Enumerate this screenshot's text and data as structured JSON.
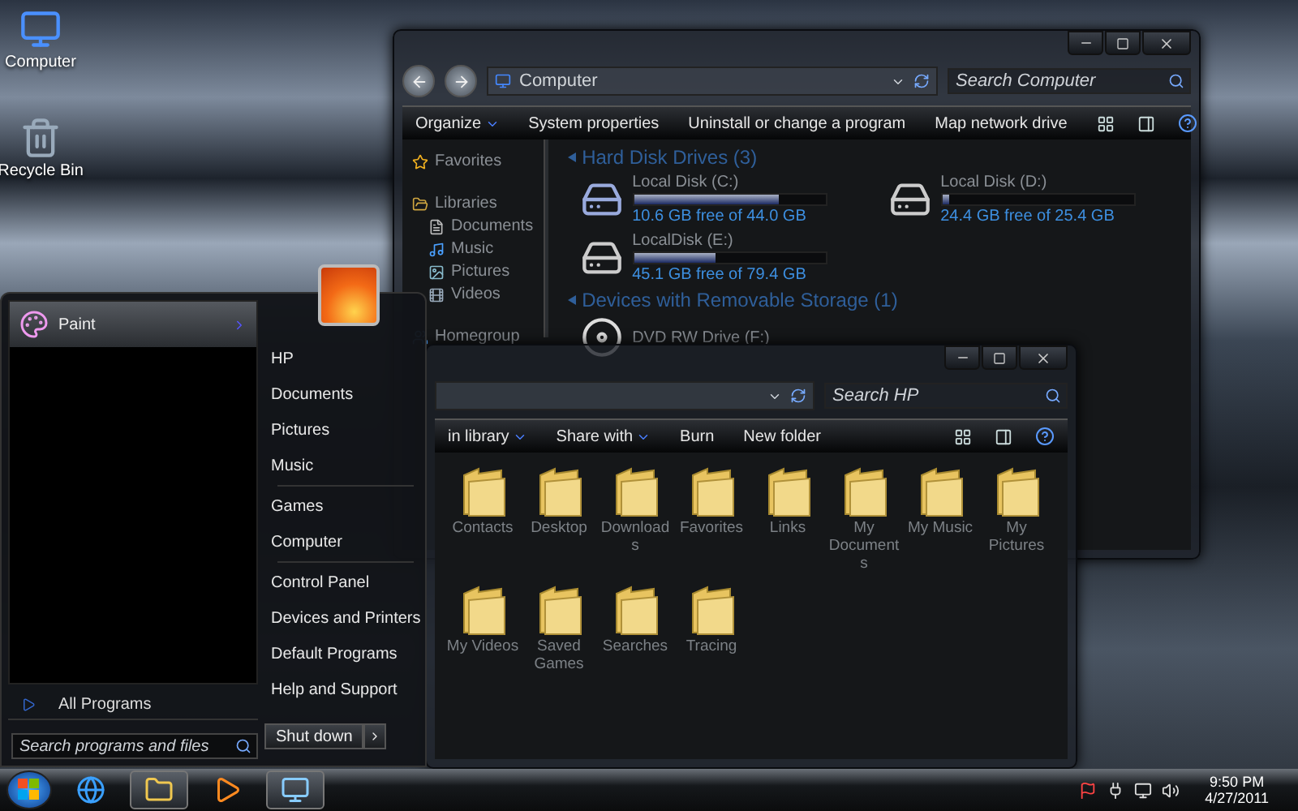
{
  "desktop_icons": [
    {
      "label": "Computer",
      "kind": "computer"
    },
    {
      "label": "Recycle Bin",
      "kind": "bin"
    }
  ],
  "computer_window": {
    "address": "Computer",
    "search": {
      "placeholder": "Search Computer"
    },
    "toolbar": [
      {
        "label": "Organize",
        "dropdown": true
      },
      {
        "label": "System properties",
        "dropdown": false
      },
      {
        "label": "Uninstall or change a program",
        "dropdown": false
      },
      {
        "label": "Map network drive",
        "dropdown": false
      }
    ],
    "nav": [
      {
        "label": "Favorites",
        "kind": "star"
      },
      {
        "label": "Libraries",
        "kind": "library",
        "children": [
          {
            "label": "Documents",
            "kind": "document"
          },
          {
            "label": "Music",
            "kind": "music"
          },
          {
            "label": "Pictures",
            "kind": "picture"
          },
          {
            "label": "Videos",
            "kind": "video"
          }
        ]
      },
      {
        "label": "Homegroup",
        "kind": "homegroup"
      }
    ],
    "groups": [
      {
        "title": "Hard Disk Drives (3)",
        "drives": [
          {
            "name": "Local Disk (C:)",
            "kind": "system",
            "level": 0.76,
            "free": "10.6 GB free of 44.0 GB"
          },
          {
            "name": "Local Disk (D:)",
            "kind": "disk",
            "level": 0.04,
            "free": "24.4 GB free of 25.4 GB"
          },
          {
            "name": "LocalDisk (E:)",
            "kind": "disk",
            "level": 0.43,
            "free": "45.1 GB free of 79.4 GB"
          }
        ]
      },
      {
        "title": "Devices with Removable Storage (1)",
        "drives": [
          {
            "name": "DVD RW Drive (F:)",
            "kind": "dvd"
          }
        ]
      }
    ]
  },
  "hp_window": {
    "search": {
      "placeholder": "Search HP"
    },
    "toolbar": [
      {
        "label": "in library",
        "dropdown": true
      },
      {
        "label": "Share with",
        "dropdown": true
      },
      {
        "label": "Burn",
        "dropdown": false
      },
      {
        "label": "New folder",
        "dropdown": false
      }
    ],
    "folders": [
      {
        "label": "Contacts"
      },
      {
        "label": "Desktop"
      },
      {
        "label": "Downloads"
      },
      {
        "label": "Favorites"
      },
      {
        "label": "Links"
      },
      {
        "label": "My Documents"
      },
      {
        "label": "My Music"
      },
      {
        "label": "My Pictures"
      },
      {
        "label": "My Videos"
      },
      {
        "label": "Saved Games"
      },
      {
        "label": "Searches"
      },
      {
        "label": "Tracing"
      }
    ]
  },
  "start_menu": {
    "pinned": [
      {
        "label": "Paint",
        "submenu": true
      }
    ],
    "places": [
      [
        "HP",
        "Documents",
        "Pictures",
        "Music"
      ],
      [
        "Games",
        "Computer"
      ],
      [
        "Control Panel",
        "Devices and Printers",
        "Default Programs",
        "Help and Support"
      ]
    ],
    "all_programs": "All Programs",
    "search": {
      "placeholder": "Search programs and files"
    },
    "shutdown": "Shut down"
  },
  "taskbar": {
    "apps": [
      {
        "kind": "browser",
        "running": false
      },
      {
        "kind": "explorer",
        "running": true
      },
      {
        "kind": "media",
        "running": false
      },
      {
        "kind": "control",
        "running": true
      }
    ],
    "time": "9:50 PM",
    "date": "4/27/2011"
  }
}
